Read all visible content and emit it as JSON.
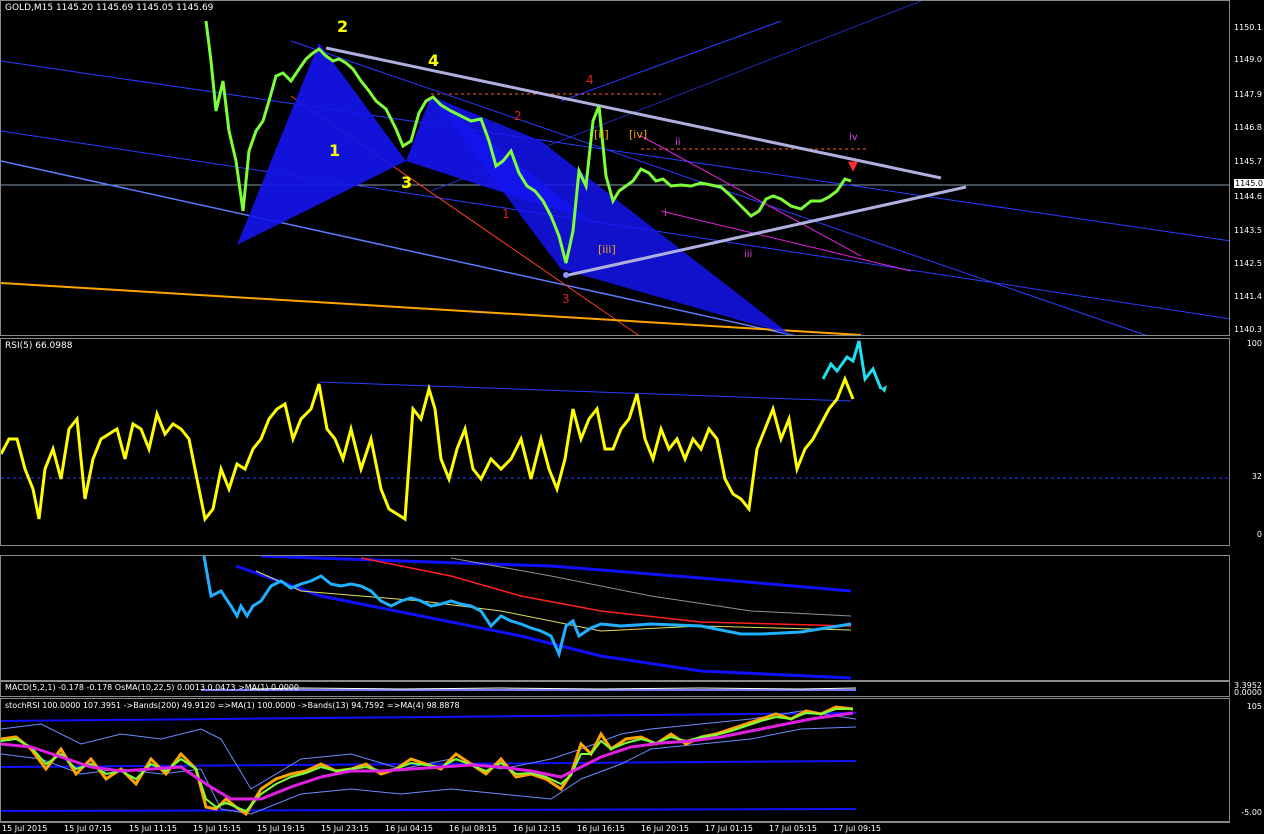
{
  "main_chart": {
    "title": "GOLD,M15  1145.20 1145.69 1145.05 1145.69",
    "price_labels": [
      "1150.1",
      "1149.0",
      "1147.9",
      "1146.8",
      "1145.7",
      "1144.6",
      "1143.5",
      "1142.5",
      "1141.4",
      "1140.3"
    ],
    "current_price": "1145.0",
    "wave_labels": {
      "w1": "1",
      "w2": "2",
      "w3": "3",
      "w4": "4",
      "r1": "1",
      "r2": "2",
      "r3": "3",
      "r4": "4",
      "ii": "[ii]",
      "iii": "[iii]",
      "iv": "[iv]",
      "m_i": "i",
      "m_ii": "ii",
      "m_iii": "iii",
      "m_iv": "iv"
    },
    "colors": {
      "candles": "#7cff3a",
      "pattern": "#1a1aff",
      "channel": "#2a3cff",
      "trend": "#b0b0e0",
      "orange": "#ffa500"
    }
  },
  "rsi_pane": {
    "title": "RSI(5) 66.0988",
    "scale": [
      "100",
      "32",
      "0"
    ],
    "colors": {
      "line": "#ffff00",
      "arrow": "#20e0f0"
    }
  },
  "bands_pane": {
    "colors": {
      "main": "#20b0ff",
      "bands": "#1010ff",
      "red": "#ff2020",
      "yellow": "#e0e060"
    }
  },
  "macd_pane": {
    "title": "MACD(5,2,1) -0.178 -0.178  OsMA(10,22,5) 0.0013 0.0473  >MA(1) 0.0000",
    "scale": [
      "3.3952",
      "0.0000"
    ]
  },
  "stoch_pane": {
    "title": "stochRSI 100.0000 107.3951  ->Bands(200) 49.9120  =>MA(1) 100.0000  ->Bands(13) 94.7592  =>MA(4) 98.8878",
    "scale": [
      "105",
      "-5.00"
    ]
  },
  "time_axis": [
    "15 Jul 2015",
    "15 Jul 07:15",
    "15 Jul 11:15",
    "15 Jul 15:15",
    "15 Jul 19:15",
    "15 Jul 23:15",
    "16 Jul 04:15",
    "16 Jul 08:15",
    "16 Jul 12:15",
    "16 Jul 16:15",
    "16 Jul 20:15",
    "17 Jul 01:15",
    "17 Jul 05:15",
    "17 Jul 09:15"
  ]
}
